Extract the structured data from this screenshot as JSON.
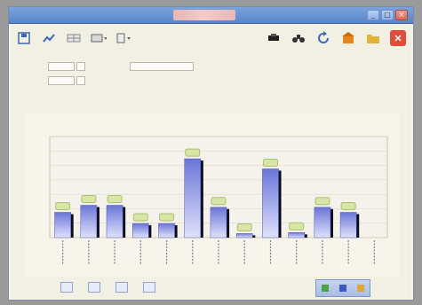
{
  "window": {
    "title": "",
    "center_title": "",
    "controls": [
      "_",
      "□",
      "×"
    ]
  },
  "toolbar": {
    "icons": [
      "save-icon",
      "chart-icon",
      "grid-icon",
      "table-icon",
      "filter-icon",
      "print-icon",
      "binoculars-icon",
      "refresh-icon",
      "home-icon",
      "folder-icon",
      "exit-icon"
    ],
    "colors": {
      "blue": "#3c68b8",
      "orange": "#e5861f",
      "red": "#e04b3a",
      "yellow": "#e2b33b"
    }
  },
  "form": {
    "field1": {
      "label": "",
      "value": ""
    },
    "field2": {
      "label": "",
      "value": ""
    },
    "field3": {
      "label": "",
      "value": ""
    },
    "right_label": "",
    "right_opts": [
      "",
      "",
      ""
    ]
  },
  "section_label": "",
  "chart_data": {
    "type": "bar",
    "title": "",
    "subtitle": "",
    "categories": [
      "",
      "",
      "",
      "",
      "",
      "",
      "",
      "",
      "",
      "",
      "",
      "",
      ""
    ],
    "values": [
      25,
      32,
      32,
      14,
      14,
      78,
      30,
      4,
      68,
      5,
      30,
      25,
      0
    ],
    "data_labels": [
      "",
      "",
      "",
      "",
      "",
      "",
      "",
      "",
      "",
      "",
      "",
      "",
      ""
    ],
    "yticks": [
      "",
      "",
      "",
      "",
      "",
      "",
      "",
      ""
    ],
    "ylim": [
      0,
      100
    ],
    "grid": true,
    "bar_color_top": "#6a75d8",
    "bar_color_bottom": "#dfe2fb",
    "label_bubble_color": "#d7e6a4"
  },
  "bottombar": {
    "items": [
      "",
      "",
      "",
      ""
    ],
    "group_colors": [
      "#4aa24a",
      "#3a5bbf",
      "#e2a53b"
    ]
  }
}
